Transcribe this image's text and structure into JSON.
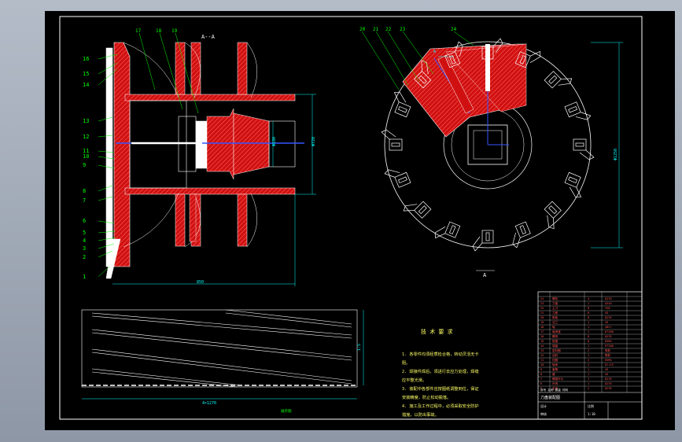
{
  "drawing": {
    "section_label": "A--A",
    "view_label": "A",
    "callouts_left": [
      "16",
      "15",
      "14",
      "13",
      "12",
      "11",
      "10",
      "9",
      "8",
      "7",
      "6",
      "5",
      "4",
      "3",
      "2",
      "1"
    ],
    "callouts_top_left": [
      "17",
      "18",
      "19"
    ],
    "callouts_top_right": [
      "20",
      "21",
      "22",
      "23",
      "24"
    ],
    "dim_length": "850",
    "dim_inner": "Φ180",
    "dim_height": "Φ720",
    "dim_diameter": "Φ1250",
    "dim_bottom": "4×1270",
    "dim_bottom_height": "1:5",
    "unfold_caption": "展开图"
  },
  "notes": {
    "title": "技 术 要 求",
    "lines": [
      "1. 各零件均须经质检合格，转动灵活无卡",
      "   阻。",
      "2. 焊接件焊后，须进行去应力处理，焊缝",
      "   应平整光滑。",
      "3. 装配中各部件应按图纸调整到位，保证",
      "   安装精度，防止松动脱落。",
      "4. 施工及工作过程中，必须采取安全防护",
      "   措施，以防出事故。"
    ]
  },
  "title_block": {
    "rows": [
      [
        "24",
        "螺栓",
        "4",
        "Q235"
      ],
      [
        "23",
        "刀盘",
        "1",
        "Q345"
      ],
      [
        "22",
        "主刀",
        "8",
        "YG8"
      ],
      [
        "21",
        "刀座",
        "8",
        "45"
      ],
      [
        "20",
        "筋板",
        "8",
        "Q235"
      ],
      [
        "19",
        "法兰",
        "1",
        "45"
      ],
      [
        "18",
        "轴",
        "1",
        "40Cr"
      ],
      [
        "17",
        "轴承座",
        "2",
        "HT200"
      ],
      [
        "16",
        "螺母",
        "8",
        "Q235"
      ],
      [
        "15",
        "垫圈",
        "8",
        "65Mn"
      ],
      [
        "14",
        "端盖",
        "1",
        "HT200"
      ],
      [
        "13",
        "密封圈",
        "2",
        "橡胶"
      ],
      [
        "12",
        "油封",
        "1",
        "橡胶"
      ],
      [
        "11",
        "挡圈",
        "2",
        "65Mn"
      ],
      [
        "10",
        "轴承",
        "2",
        "GCr15"
      ],
      [
        "9",
        "套筒",
        "1",
        "45"
      ],
      [
        "8",
        "键",
        "1",
        "45"
      ],
      [
        "7",
        "螺旋叶片",
        "1",
        "Q235"
      ],
      [
        "6",
        "外壳",
        "1",
        "Q235"
      ],
      [
        "5",
        "支架",
        "2",
        "Q235"
      ]
    ],
    "header": "序号 名称 数量 材料",
    "drawing_name": "刀盘装配图",
    "scale_label": "比例",
    "scale": "1:10",
    "designer": "设计",
    "checker": "审核"
  },
  "colors": {
    "sheet": "#000000",
    "line": "#ffffff",
    "part": "#ff3030",
    "callout": "#00ff00",
    "dimension": "#00ffff",
    "frame": "#ffffff"
  }
}
